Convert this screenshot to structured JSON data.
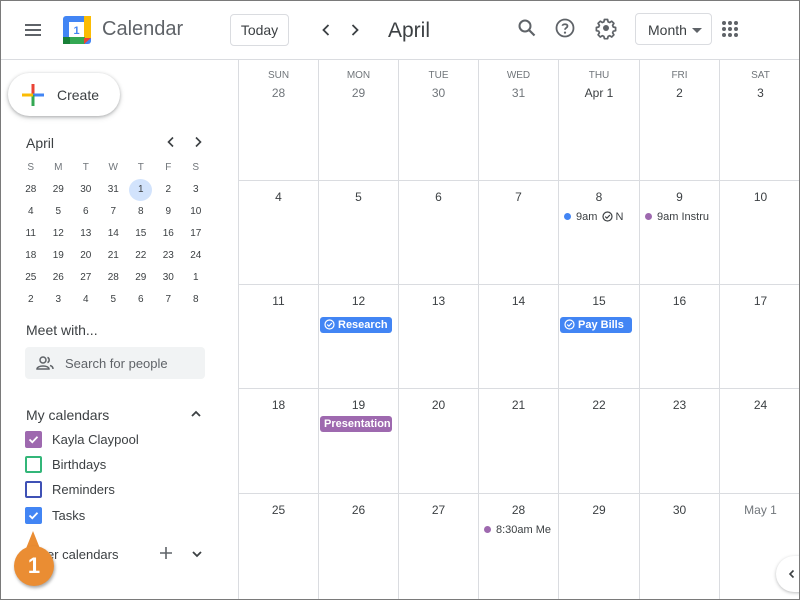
{
  "header": {
    "app_title": "Calendar",
    "logo_day": "1",
    "today_label": "Today",
    "month_title": "April",
    "view_selected": "Month",
    "icons": [
      "menu-icon",
      "prev-icon",
      "next-icon",
      "search-icon",
      "help-icon",
      "settings-icon",
      "apps-grid-icon"
    ]
  },
  "sidebar": {
    "create_label": "Create",
    "mini_calendar": {
      "month": "April",
      "dow": [
        "S",
        "M",
        "T",
        "W",
        "T",
        "F",
        "S"
      ],
      "weeks": [
        [
          "28",
          "29",
          "30",
          "31",
          "1",
          "2",
          "3"
        ],
        [
          "4",
          "5",
          "6",
          "7",
          "8",
          "9",
          "10"
        ],
        [
          "11",
          "12",
          "13",
          "14",
          "15",
          "16",
          "17"
        ],
        [
          "18",
          "19",
          "20",
          "21",
          "22",
          "23",
          "24"
        ],
        [
          "25",
          "26",
          "27",
          "28",
          "29",
          "30",
          "1"
        ],
        [
          "2",
          "3",
          "4",
          "5",
          "6",
          "7",
          "8"
        ]
      ],
      "today": "1"
    },
    "meet_title": "Meet with...",
    "people_search_placeholder": "Search for people",
    "my_calendars_title": "My calendars",
    "my_calendars": [
      {
        "label": "Kayla Claypool",
        "checked": true,
        "color": "#9e69af"
      },
      {
        "label": "Birthdays",
        "checked": false,
        "color": "#33b679"
      },
      {
        "label": "Reminders",
        "checked": false,
        "color": "#3f51b5"
      },
      {
        "label": "Tasks",
        "checked": true,
        "color": "#4285f4"
      }
    ],
    "other_calendars_title": "Other calendars",
    "callout_number": "1"
  },
  "grid": {
    "dow": [
      "SUN",
      "MON",
      "TUE",
      "WED",
      "THU",
      "FRI",
      "SAT"
    ],
    "weeks": [
      {
        "days": [
          "28",
          "29",
          "30",
          "31",
          "Apr 1",
          "2",
          "3"
        ]
      },
      {
        "days": [
          "4",
          "5",
          "6",
          "7",
          "8",
          "9",
          "10"
        ]
      },
      {
        "days": [
          "11",
          "12",
          "13",
          "14",
          "15",
          "16",
          "17"
        ]
      },
      {
        "days": [
          "18",
          "19",
          "20",
          "21",
          "22",
          "23",
          "24"
        ]
      },
      {
        "days": [
          "25",
          "26",
          "27",
          "28",
          "29",
          "30",
          "May 1"
        ]
      }
    ],
    "events": [
      {
        "week": 1,
        "day": 4,
        "type": "dot",
        "time": "9am",
        "title": "N",
        "task": true,
        "color": "#4285f4"
      },
      {
        "week": 1,
        "day": 5,
        "type": "dot",
        "time": "9am",
        "title": "Instru",
        "task": false,
        "color": "#9e69af"
      },
      {
        "week": 2,
        "day": 1,
        "type": "chip",
        "title": "Research",
        "task": true,
        "color": "#4285f4"
      },
      {
        "week": 2,
        "day": 4,
        "type": "chip",
        "title": "Pay Bills",
        "task": true,
        "color": "#4285f4"
      },
      {
        "week": 3,
        "day": 1,
        "type": "chip",
        "title": "Presentation",
        "task": false,
        "color": "#9e69af"
      },
      {
        "week": 4,
        "day": 3,
        "type": "dot",
        "time": "8:30am",
        "title": "Me",
        "task": false,
        "color": "#9e69af"
      }
    ]
  },
  "colors": {
    "task_blue": "#4285f4",
    "personal_purple": "#9e69af",
    "today_highlight": "#d2e3fc",
    "callout_orange": "#ea8d33"
  }
}
